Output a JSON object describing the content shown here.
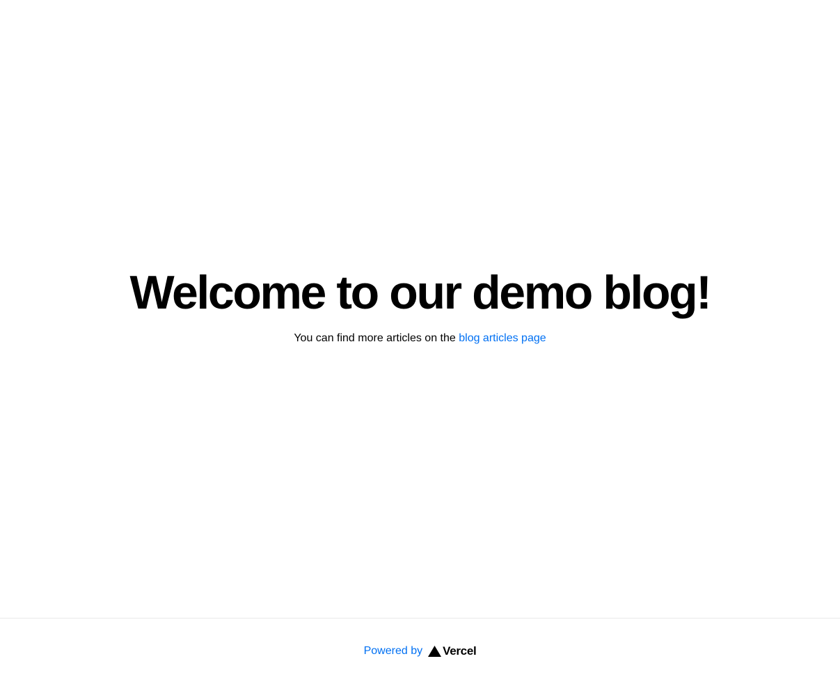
{
  "main": {
    "title": "Welcome to our demo blog!",
    "description_prefix": "You can find more articles on the ",
    "description_link": "blog articles page"
  },
  "footer": {
    "powered_by": "Powered by",
    "logo": {
      "icon": "triangle-icon",
      "text": "Vercel"
    }
  },
  "colors": {
    "link": "#0070f3",
    "divider": "#eaeaea",
    "text": "#000000",
    "background": "#ffffff"
  }
}
